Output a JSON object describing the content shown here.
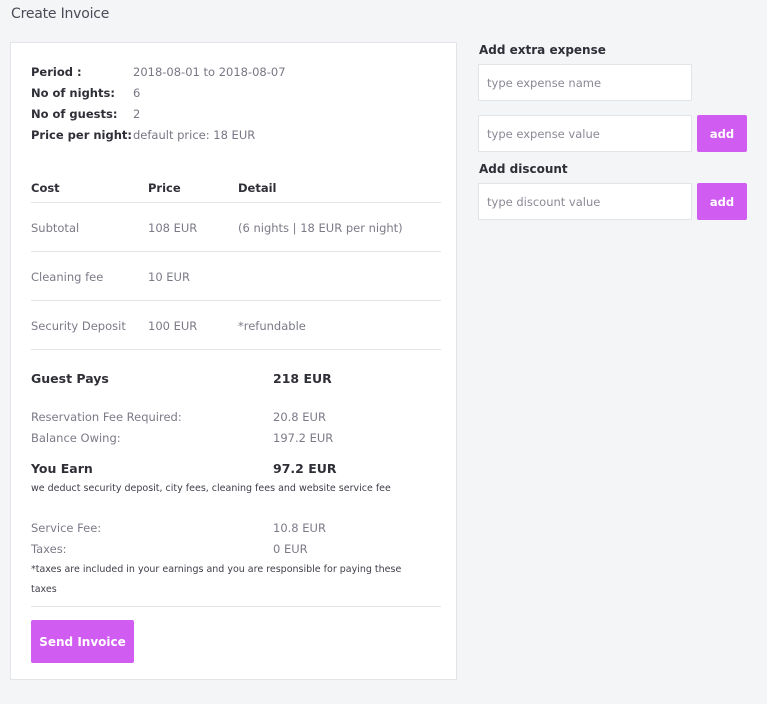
{
  "page": {
    "title": "Create Invoice"
  },
  "meta": {
    "period_label": "Period :",
    "period_value": "2018-08-01 to 2018-08-07",
    "nights_label": "No of nights:",
    "nights_value": "6",
    "guests_label": "No of guests:",
    "guests_value": "2",
    "price_label": "Price per night:",
    "price_value": "default price: 18 EUR"
  },
  "table": {
    "headers": {
      "cost": "Cost",
      "price": "Price",
      "detail": "Detail"
    },
    "rows": [
      {
        "cost": "Subtotal",
        "price": "108 EUR",
        "detail": "(6 nights | 18 EUR per night)"
      },
      {
        "cost": "Cleaning fee",
        "price": "10 EUR",
        "detail": ""
      },
      {
        "cost": "Security Deposit",
        "price": "100 EUR",
        "detail": "*refundable"
      }
    ]
  },
  "summary": {
    "guest_pays_label": "Guest Pays",
    "guest_pays_value": "218 EUR",
    "reservation_fee_label": "Reservation Fee Required:",
    "reservation_fee_value": "20.8 EUR",
    "balance_label": "Balance Owing:",
    "balance_value": "197.2 EUR",
    "you_earn_label": "You Earn",
    "you_earn_value": "97.2 EUR",
    "earn_note": "we deduct security deposit, city fees, cleaning fees and website service fee",
    "service_fee_label": "Service Fee:",
    "service_fee_value": "10.8 EUR",
    "taxes_label": "Taxes:",
    "taxes_value": "0 EUR",
    "taxes_note_1": "*taxes are included in your earnings and you are responsible for paying these",
    "taxes_note_2": "taxes"
  },
  "actions": {
    "send_label": "Send Invoice"
  },
  "sidebar": {
    "extra_title": "Add extra expense",
    "expense_name_placeholder": "type expense name",
    "expense_value_placeholder": "type expense value",
    "add_expense_label": "add",
    "discount_title": "Add discount",
    "discount_placeholder": "type discount value",
    "add_discount_label": "add"
  },
  "colors": {
    "accent": "#d15cf2",
    "background": "#f4f5f7"
  }
}
